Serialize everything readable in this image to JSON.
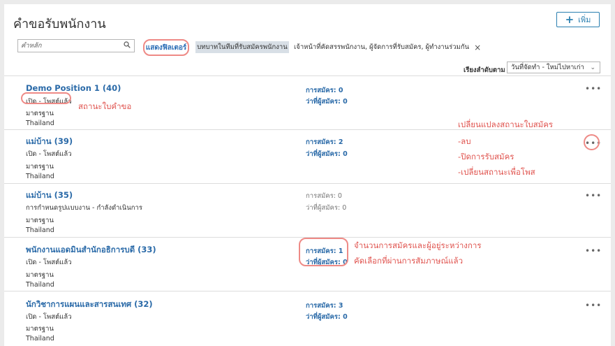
{
  "page_title": "คำขอรับพนักงาน",
  "add_button": {
    "icon": "plus-icon",
    "label": "เพิ่ม"
  },
  "search": {
    "placeholder": "คำหลัก",
    "icon": "search-icon"
  },
  "filter_button": "แสดงฟิลเตอร์",
  "filter_chips": [
    {
      "label": "บทบาทในทีมที่รับสมัครพนักงาน"
    },
    {
      "label": "เจ้าหน้าที่คัดสรรพนักงาน, ผู้จัดการที่รับสมัคร, ผู้ทำงานร่วมกัน",
      "remove": "×"
    }
  ],
  "sort": {
    "label": "เรียงลำดับตาม",
    "selected": "วันที่จัดทำ - ใหม่ไปหาเก่า"
  },
  "rows": [
    {
      "title": "Demo Position 1 (40)",
      "status": "เปิด - โพสต์แล้ว",
      "type": "มาตรฐาน",
      "country": "Thailand",
      "applications": "การสมัคร: 0",
      "interviewing": "ว่าที่ผู้สมัคร: 0",
      "more": "•••"
    },
    {
      "title": "แม่บ้าน (39)",
      "status": "เปิด - โพสต์แล้ว",
      "type": "มาตรฐาน",
      "country": "Thailand",
      "applications": "การสมัคร: 2",
      "interviewing": "ว่าที่ผู้สมัคร: 0",
      "more": "•••"
    },
    {
      "title": "แม่บ้าน (35)",
      "status": "การกำหนดรูปแบบงาน - กำลังดำเนินการ",
      "type": "มาตรฐาน",
      "country": "Thailand",
      "applications": "การสมัคร: 0",
      "interviewing": "ว่าที่ผู้สมัคร: 0",
      "more": "•••"
    },
    {
      "title": "พนักงานแอดมินสำนักอธิการบดี (33)",
      "status": "เปิด - โพสต์แล้ว",
      "type": "มาตรฐาน",
      "country": "Thailand",
      "applications": "การสมัคร: 1",
      "interviewing": "ว่าที่ผู้สมัคร: 0",
      "more": "•••"
    },
    {
      "title": "นักวิชาการแผนและสารสนเทศ (32)",
      "status": "เปิด - โพสต์แล้ว",
      "type": "มาตรฐาน",
      "country": "Thailand",
      "applications": "การสมัคร: 3",
      "interviewing": "ว่าที่ผู้สมัคร: 0",
      "more": "•••"
    }
  ],
  "annotations": {
    "status_note": "สถานะใบคำขอ",
    "change_status": "เปลี่ยนแปลงสถานะใบสมัคร",
    "opt_delete": "-ลบ",
    "opt_close": "-ปิดการรับสมัคร",
    "opt_post": "-เปลี่ยนสถานะเพื่อโพส",
    "count_note_1": "จำนวนการสมัครและผู้อยู่ระหว่างการ",
    "count_note_2": "คัดเลือกที่ผ่านการสัมภาษณ์แล้ว",
    "color": "#e0544f"
  }
}
